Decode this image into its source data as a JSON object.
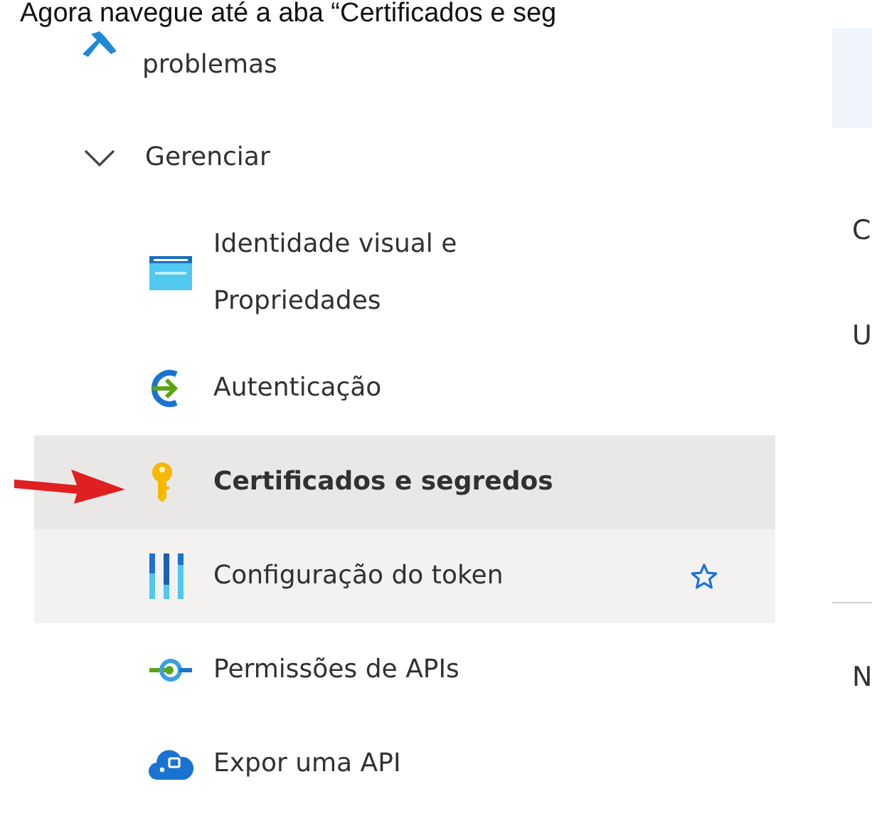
{
  "caption": "Agora navegue até a aba “Certificados e seg",
  "nav": {
    "items": [
      {
        "label": "problemas",
        "kind": "tools",
        "selected": false,
        "hovered": false
      },
      {
        "label": "Gerenciar",
        "expanded": true,
        "children": [
          {
            "label": "Identidade visual e Propriedades",
            "kind": "branding",
            "selected": false,
            "hovered": false
          },
          {
            "label": "Autenticação",
            "kind": "auth",
            "selected": false,
            "hovered": false
          },
          {
            "label": "Certificados e segredos",
            "kind": "key",
            "selected": true,
            "hovered": false
          },
          {
            "label": "Configuração do token",
            "kind": "token",
            "selected": false,
            "hovered": true
          },
          {
            "label": "Permissões de APIs",
            "kind": "permissions",
            "selected": false,
            "hovered": false
          },
          {
            "label": "Expor uma API",
            "kind": "cloud",
            "selected": false,
            "hovered": false
          }
        ]
      }
    ]
  },
  "right_pane": {
    "texts": [
      "C",
      "U",
      "N"
    ]
  }
}
